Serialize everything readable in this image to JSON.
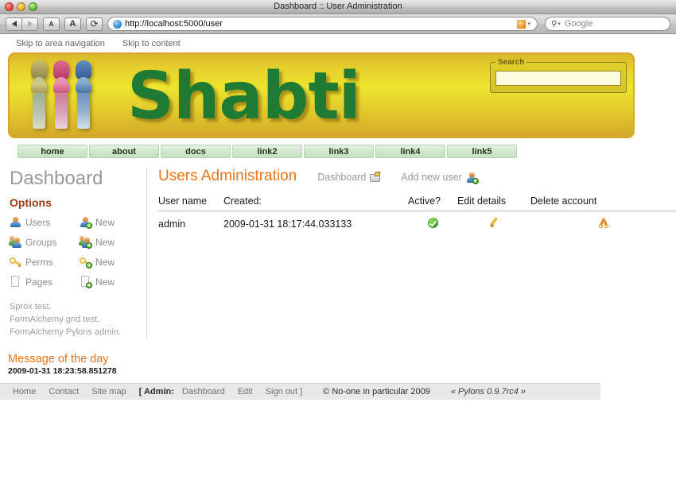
{
  "browser": {
    "window_title": "Dashboard :: User Administration",
    "back_label": "◀",
    "forward_label": "▶",
    "text_smaller_label": "A",
    "text_larger_label": "A",
    "reload_label": "⟳",
    "url": "http://localhost:5000/user",
    "search_placeholder": "Google",
    "favicon_name": "globe-icon",
    "rss_icon_name": "rss-icon"
  },
  "skip_links": [
    {
      "label": "Skip to area navigation"
    },
    {
      "label": "Skip to content"
    }
  ],
  "banner": {
    "wordmark": "Shabti",
    "search_legend": "Search",
    "search_value": "",
    "search_placeholder": ""
  },
  "nav_tabs": [
    {
      "label": "home"
    },
    {
      "label": "about"
    },
    {
      "label": "docs"
    },
    {
      "label": "link2"
    },
    {
      "label": "link3"
    },
    {
      "label": "link4"
    },
    {
      "label": "link5"
    }
  ],
  "sidebar": {
    "title": "Dashboard",
    "options_heading": "Options",
    "options": [
      {
        "label": "Users",
        "new_label": "New"
      },
      {
        "label": "Groups",
        "new_label": "New"
      },
      {
        "label": "Perms",
        "new_label": "New"
      },
      {
        "label": "Pages",
        "new_label": "New"
      }
    ],
    "links": [
      {
        "label": "Sprox test."
      },
      {
        "label": "FormAlchemy grid test."
      },
      {
        "label": "FormAlchemy Pylons admin."
      }
    ]
  },
  "main": {
    "title": "Users Administration",
    "dashboard_link": "Dashboard",
    "add_user_link": "Add new user",
    "table": {
      "headers": {
        "user_name": "User name",
        "created": "Created:",
        "active": "Active?",
        "edit": "Edit details",
        "delete": "Delete account"
      },
      "rows": [
        {
          "user_name": "admin",
          "created": "2009-01-31 18:17:44.033133",
          "active": true
        }
      ]
    }
  },
  "motd": {
    "title": "Message of the day",
    "timestamp": "2009-01-31 18:23:58.851278"
  },
  "footer": {
    "home": "Home",
    "contact": "Contact",
    "site_map": "Site map",
    "admin_label": "[ Admin:",
    "dashboard": "Dashboard",
    "edit": "Edit",
    "sign_out": "Sign out ]",
    "copyright": "© No-one in particular 2009",
    "powered_by": "« Pylons 0.9.7rc4 »"
  },
  "colors": {
    "banner_gold": "#e2c82c",
    "wordmark_green": "#1f7a33",
    "heading_orange": "#e8751a",
    "options_red": "#9c3b14",
    "tab_green": "#cfe6cb",
    "active_green": "#2f9c1d"
  }
}
